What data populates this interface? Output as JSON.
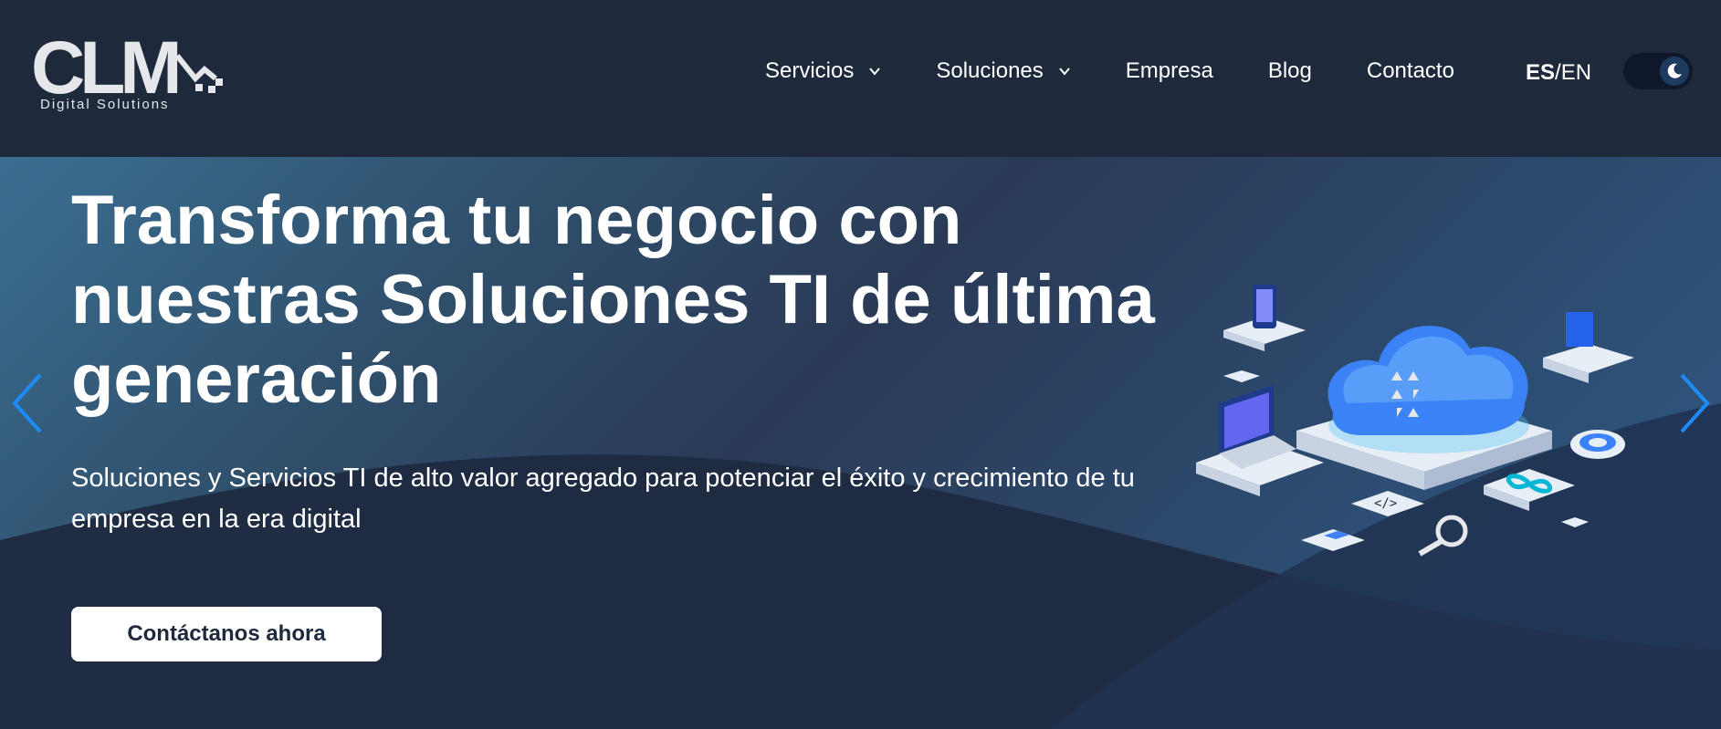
{
  "brand": {
    "logo_text": "CLM",
    "tagline": "Digital Solutions"
  },
  "nav": {
    "items": [
      {
        "label": "Servicios",
        "has_dropdown": true
      },
      {
        "label": "Soluciones",
        "has_dropdown": true
      },
      {
        "label": "Empresa",
        "has_dropdown": false
      },
      {
        "label": "Blog",
        "has_dropdown": false
      },
      {
        "label": "Contacto",
        "has_dropdown": false
      }
    ],
    "lang_active": "ES",
    "lang_separator": "/",
    "lang_other": "EN",
    "theme_toggle_icon": "moon-icon"
  },
  "hero": {
    "title": "Transforma tu negocio con nuestras Soluciones TI de última generación",
    "subtitle": "Soluciones y Servicios TI de alto valor agregado para potenciar el éxito y crecimiento de tu empresa en la era digital",
    "cta_label": "Contáctanos ahora",
    "prev_icon": "chevron-left-icon",
    "next_icon": "chevron-right-icon"
  },
  "colors": {
    "header_bg": "#1e293b",
    "accent_arrow": "#1d8cf8",
    "cta_bg": "#ffffff",
    "cta_text": "#1e293b"
  }
}
